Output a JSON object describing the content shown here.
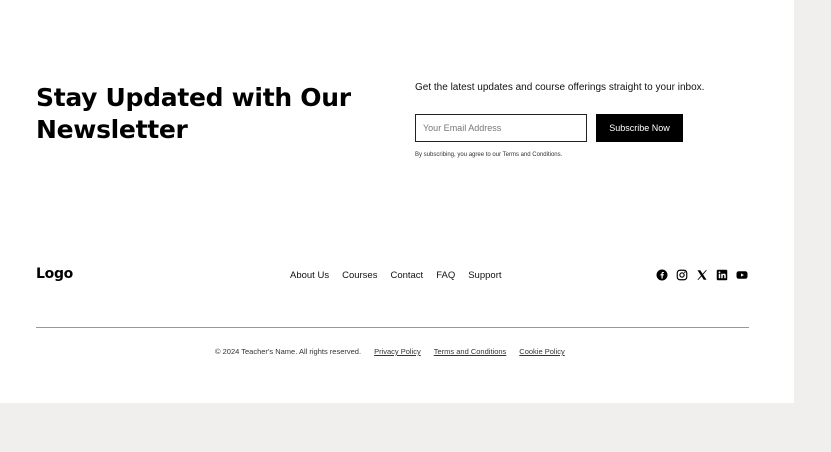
{
  "newsletter": {
    "title": "Stay Updated with Our Newsletter",
    "description": "Get the latest updates and course offerings straight to your inbox.",
    "email_placeholder": "Your Email Address",
    "email_value": "",
    "subscribe_label": "Subscribe Now",
    "disclaimer": "By subscribing, you agree to our Terms and Conditions."
  },
  "footer": {
    "logo": "Logo",
    "nav": [
      {
        "label": "About Us"
      },
      {
        "label": "Courses"
      },
      {
        "label": "Contact"
      },
      {
        "label": "FAQ"
      },
      {
        "label": "Support"
      }
    ],
    "social": [
      {
        "icon": "facebook-icon"
      },
      {
        "icon": "instagram-icon"
      },
      {
        "icon": "x-icon"
      },
      {
        "icon": "linkedin-icon"
      },
      {
        "icon": "youtube-icon"
      }
    ],
    "copyright": "© 2024 Teacher's Name. All rights reserved.",
    "legal": [
      {
        "label": "Privacy Policy"
      },
      {
        "label": "Terms and Conditions"
      },
      {
        "label": "Cookie Policy"
      }
    ]
  },
  "colors": {
    "background_outer": "#f0efed",
    "page": "#ffffff",
    "button": "#000000",
    "divider": "#999999"
  }
}
